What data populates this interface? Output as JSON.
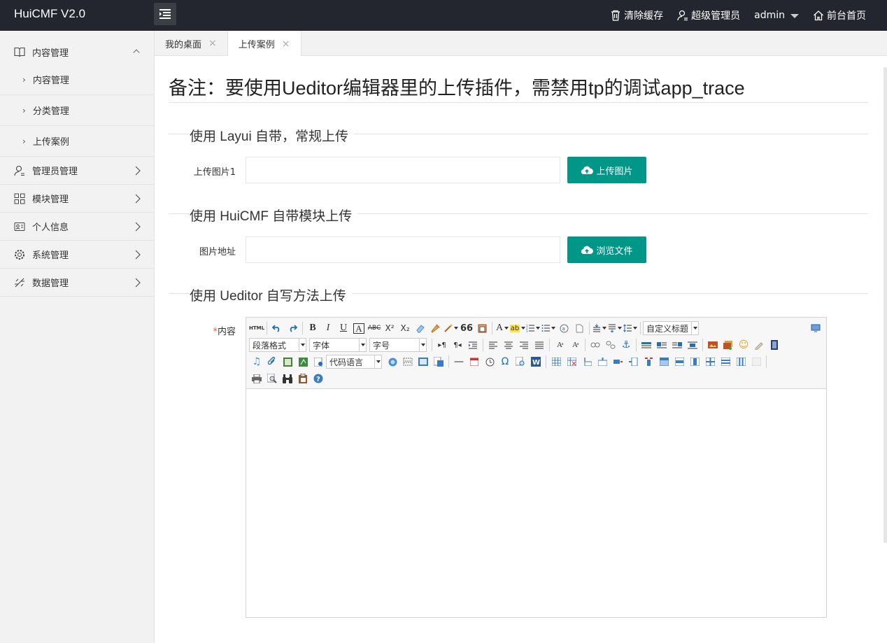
{
  "app": {
    "title": "HuiCMF V2.0"
  },
  "header": {
    "clear_cache": "清除缓存",
    "role": "超级管理员",
    "user": "admin",
    "front_home": "前台首页"
  },
  "sidebar": {
    "groups": [
      {
        "label": "内容管理",
        "open": true,
        "children": [
          "内容管理",
          "分类管理",
          "上传案例"
        ]
      },
      {
        "label": "管理员管理"
      },
      {
        "label": "模块管理"
      },
      {
        "label": "个人信息"
      },
      {
        "label": "系统管理"
      },
      {
        "label": "数据管理"
      }
    ]
  },
  "tabs": [
    {
      "label": "我的桌面",
      "close": "×"
    },
    {
      "label": "上传案例",
      "close": "×",
      "active": true
    }
  ],
  "main": {
    "title": "备注：要使用Ueditor编辑器里的上传插件，需禁用tp的调试app_trace",
    "section1": {
      "legend": "使用 Layui 自带，常规上传",
      "label": "上传图片1",
      "input_value": "",
      "button": "上传图片"
    },
    "section2": {
      "legend": "使用 HuiCMF 自带模块上传",
      "label": "图片地址",
      "input_value": "",
      "button": "浏览文件"
    },
    "section3": {
      "legend": "使用 Ueditor 自写方法上传",
      "required_mark": "*",
      "label": "内容"
    }
  },
  "editor": {
    "html_btn": "HTML",
    "custom_title": "自定义标题",
    "paragraph_format": "段落格式",
    "font_family": "字体",
    "font_size": "字号",
    "code_language": "代码语言",
    "bold": "B",
    "italic": "I",
    "underline": "U",
    "font_border": "A",
    "strike": "ABC",
    "sup": "X²",
    "sub": "X₂",
    "quote": "66",
    "font_color": "A",
    "omega": "Ω"
  },
  "colors": {
    "topbar": "#23262e",
    "accent": "#009688",
    "sidebar": "#f2f2f2"
  }
}
